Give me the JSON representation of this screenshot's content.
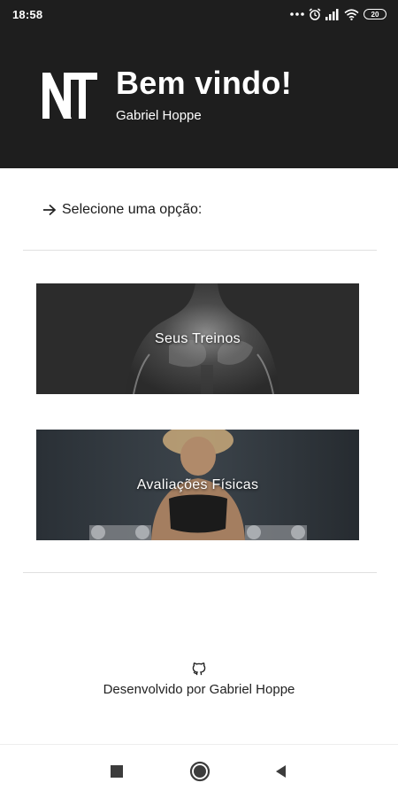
{
  "status_bar": {
    "time": "18:58",
    "battery": "20",
    "icons": [
      "more-dots-icon",
      "alarm-icon",
      "signal-icon",
      "wifi-icon",
      "battery-icon"
    ]
  },
  "header": {
    "title": "Bem vindo!",
    "subtitle": "Gabriel Hoppe",
    "logo": "NT"
  },
  "main": {
    "prompt": "Selecione uma opção:",
    "cards": [
      {
        "label": "Seus Treinos"
      },
      {
        "label": "Avaliações Físicas"
      }
    ]
  },
  "footer": {
    "text": "Desenvolvido por Gabriel Hoppe",
    "icon": "github-icon"
  },
  "navigation": {
    "buttons": [
      "recents-button",
      "home-button",
      "back-button"
    ]
  },
  "colors": {
    "header_bg": "#1e1e1e",
    "text_on_dark": "#ffffff",
    "divider": "#e0e0e0"
  }
}
